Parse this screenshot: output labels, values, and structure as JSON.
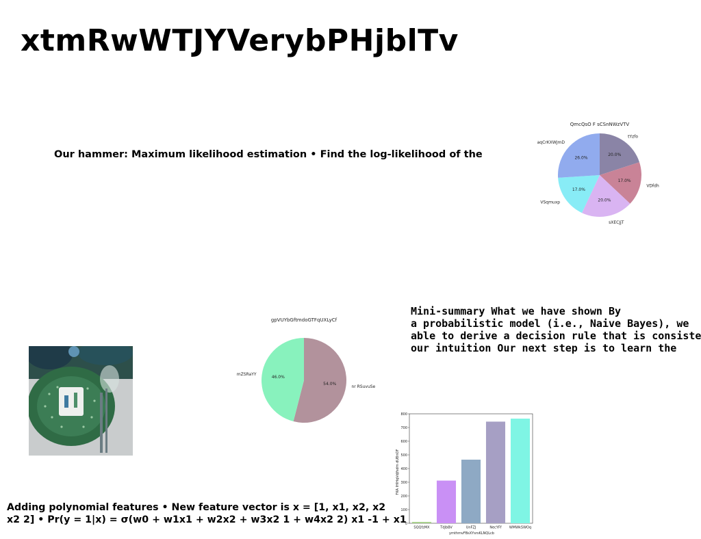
{
  "title": "xtmRwWTJYVerybPHjblTv",
  "text_blocks": {
    "mle": "Our hammer: Maximum likelihood estimation • Find the log-likelihood of the",
    "summary_lines": [
      "Mini-summary What we have shown By",
      "a probabilistic model (i.e., Naive Bayes), we",
      "able to derive a decision rule that is consistent",
      "our intuition Our next step is to learn the"
    ],
    "poly_lines": [
      "Adding polynomial features • New feature vector is x = [1, x1, x2, x2",
      "x2 2] • Pr(y = 1|x) = σ(w0 + w1x1 + w2x2 + w3x2 1 + w4x2 2) x1 -1 + x1"
    ]
  },
  "image": {
    "description_icon": "dinner-plate-photo"
  },
  "chart_data": [
    {
      "type": "pie",
      "title": "QmcQsO F sCSnNWzVTV",
      "slices": [
        {
          "label": "tYzfo",
          "value": 20.0,
          "color": "#8a84a6"
        },
        {
          "label": "VDfdh",
          "value": 17.0,
          "color": "#c98397"
        },
        {
          "label": "sXECJjT",
          "value": 20.0,
          "color": "#d9b4f2"
        },
        {
          "label": "VSqmuxp",
          "value": 17.0,
          "color": "#88ecf6"
        },
        {
          "label": "aqCrKXWJmD",
          "value": 26.0,
          "color": "#91abee"
        }
      ]
    },
    {
      "type": "pie",
      "title": "gpVUYbGftmdoGTFqUXLyCf",
      "slices": [
        {
          "label": "nr RSuvuSe",
          "value": 54.0,
          "color": "#b2929c"
        },
        {
          "label": "mZSRaYY",
          "value": 46.0,
          "color": "#88f2bd"
        }
      ]
    },
    {
      "type": "bar",
      "categories": [
        "SQQfzMX",
        "TdJbBV",
        "UnFZJ",
        "NecYFf",
        "WMWkSWOq"
      ],
      "values": [
        10,
        312,
        465,
        743,
        765
      ],
      "colors": [
        "#a8d08d",
        "#c990f5",
        "#8ea9c4",
        "#a69fc4",
        "#7ff5e4"
      ],
      "xlabel": "ymthmvFBsXYsrsKLNQLcb",
      "ylabel": "FKA IHlHqVdjfsdm dUBnOF",
      "ylim": [
        0,
        800
      ],
      "yticks": [
        0,
        100,
        200,
        300,
        400,
        500,
        600,
        700,
        800
      ]
    }
  ]
}
